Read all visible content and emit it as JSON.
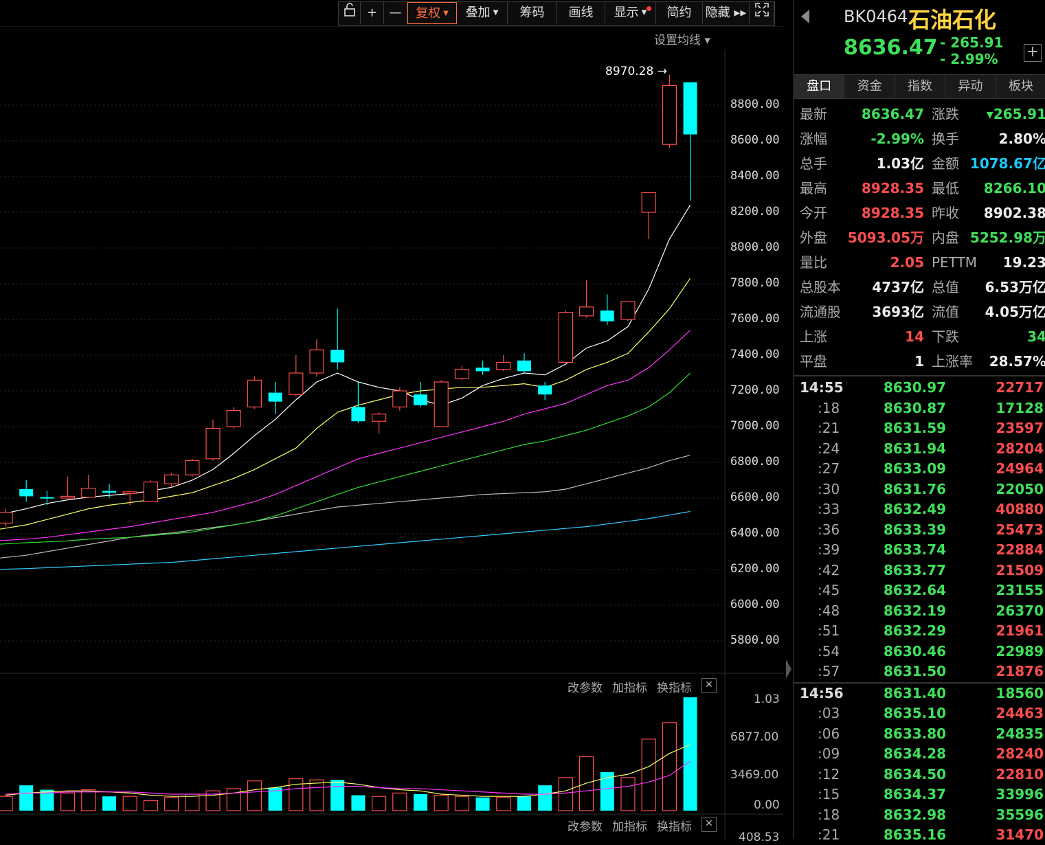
{
  "toolbar": {
    "items": [
      {
        "label": "",
        "icon": "unlock-icon"
      },
      {
        "label": "+",
        "icon": "zoom-in-icon"
      },
      {
        "label": "—",
        "icon": "zoom-out-icon"
      },
      {
        "label": "复权",
        "caret": true,
        "active": true
      },
      {
        "label": "叠加",
        "caret": true
      },
      {
        "label": "筹码"
      },
      {
        "label": "画线"
      },
      {
        "label": "显示",
        "caret": true,
        "dot": true
      },
      {
        "label": "简约"
      },
      {
        "label": "隐藏 ▸▸"
      },
      {
        "label": "",
        "icon": "fullscreen-icon"
      }
    ]
  },
  "main_chart": {
    "setting_label": "设置均线 ▾",
    "peak_label": "8970.28",
    "y_axis_labels": [
      "8800.00",
      "8600.00",
      "8400.00",
      "8200.00",
      "8000.00",
      "7800.00",
      "7600.00",
      "7400.00",
      "7200.00",
      "7000.00",
      "6800.00",
      "6600.00",
      "6400.00",
      "6200.00",
      "6000.00",
      "5800.00"
    ]
  },
  "volume_chart": {
    "tools": [
      "改参数",
      "加指标",
      "换指标"
    ],
    "y_axis_labels": [
      "1.03",
      "6877.00",
      "3469.00",
      "0.00"
    ]
  },
  "bottom_chart": {
    "tools": [
      "改参数",
      "加指标",
      "换指标"
    ],
    "y_axis_label": "408.53"
  },
  "colors": {
    "up": "#ff4d4d",
    "down": "#00ffff",
    "ma5": "#ffffff",
    "ma10": "#ffff66",
    "ma20": "#ff33ff",
    "ma30": "#33dd33",
    "ma60": "#bbbbbb",
    "ma120": "#33ccff"
  },
  "chart_data": {
    "type": "candlestick",
    "ylim": [
      5700,
      9000
    ],
    "candles": [
      {
        "o": 6520,
        "c": 6460,
        "h": 6540,
        "l": 6440,
        "up": true
      },
      {
        "o": 6650,
        "c": 6610,
        "h": 6700,
        "l": 6580,
        "up": false
      },
      {
        "o": 6605,
        "c": 6600,
        "h": 6640,
        "l": 6560,
        "up": false
      },
      {
        "o": 6600,
        "c": 6610,
        "h": 6720,
        "l": 6600,
        "up": true
      },
      {
        "o": 6605,
        "c": 6655,
        "h": 6730,
        "l": 6600,
        "up": true
      },
      {
        "o": 6640,
        "c": 6630,
        "h": 6680,
        "l": 6600,
        "up": false
      },
      {
        "o": 6625,
        "c": 6635,
        "h": 6640,
        "l": 6560,
        "up": true
      },
      {
        "o": 6580,
        "c": 6690,
        "h": 6700,
        "l": 6580,
        "up": true
      },
      {
        "o": 6680,
        "c": 6730,
        "h": 6740,
        "l": 6660,
        "up": true
      },
      {
        "o": 6730,
        "c": 6810,
        "h": 6820,
        "l": 6720,
        "up": true
      },
      {
        "o": 6820,
        "c": 6990,
        "h": 7040,
        "l": 6810,
        "up": true
      },
      {
        "o": 7000,
        "c": 7090,
        "h": 7110,
        "l": 6990,
        "up": true
      },
      {
        "o": 7110,
        "c": 7260,
        "h": 7280,
        "l": 7100,
        "up": true
      },
      {
        "o": 7190,
        "c": 7140,
        "h": 7250,
        "l": 7070,
        "up": false
      },
      {
        "o": 7180,
        "c": 7300,
        "h": 7400,
        "l": 7170,
        "up": true
      },
      {
        "o": 7300,
        "c": 7430,
        "h": 7490,
        "l": 7280,
        "up": true
      },
      {
        "o": 7430,
        "c": 7360,
        "h": 7660,
        "l": 7320,
        "up": false
      },
      {
        "o": 7110,
        "c": 7030,
        "h": 7250,
        "l": 7020,
        "up": false
      },
      {
        "o": 7030,
        "c": 7070,
        "h": 7080,
        "l": 6960,
        "up": true
      },
      {
        "o": 7110,
        "c": 7200,
        "h": 7220,
        "l": 7090,
        "up": true
      },
      {
        "o": 7180,
        "c": 7120,
        "h": 7250,
        "l": 7110,
        "up": false
      },
      {
        "o": 7000,
        "c": 7250,
        "h": 7260,
        "l": 7000,
        "up": true
      },
      {
        "o": 7270,
        "c": 7320,
        "h": 7340,
        "l": 7260,
        "up": true
      },
      {
        "o": 7330,
        "c": 7310,
        "h": 7370,
        "l": 7290,
        "up": false
      },
      {
        "o": 7320,
        "c": 7360,
        "h": 7400,
        "l": 7310,
        "up": true
      },
      {
        "o": 7370,
        "c": 7310,
        "h": 7410,
        "l": 7300,
        "up": false
      },
      {
        "o": 7230,
        "c": 7180,
        "h": 7250,
        "l": 7150,
        "up": false
      },
      {
        "o": 7360,
        "c": 7640,
        "h": 7650,
        "l": 7350,
        "up": true
      },
      {
        "o": 7620,
        "c": 7670,
        "h": 7820,
        "l": 7610,
        "up": true
      },
      {
        "o": 7650,
        "c": 7590,
        "h": 7740,
        "l": 7570,
        "up": false
      },
      {
        "o": 7600,
        "c": 7700,
        "h": 7700,
        "l": 7590,
        "up": true
      },
      {
        "o": 8200,
        "c": 8310,
        "h": 8310,
        "l": 8050,
        "up": true
      },
      {
        "o": 8580,
        "c": 8910,
        "h": 8970,
        "l": 8560,
        "up": true
      },
      {
        "o": 8928,
        "c": 8636,
        "h": 8928,
        "l": 8266,
        "up": false
      }
    ],
    "ma5": [
      6500,
      6540,
      6570,
      6590,
      6605,
      6615,
      6625,
      6640,
      6660,
      6700,
      6760,
      6850,
      6950,
      7040,
      7150,
      7250,
      7300,
      7250,
      7220,
      7200,
      7150,
      7120,
      7160,
      7230,
      7270,
      7300,
      7290,
      7350,
      7440,
      7480,
      7560,
      7770,
      8050,
      8240
    ],
    "ma10": [
      6420,
      6450,
      6480,
      6510,
      6540,
      6560,
      6575,
      6590,
      6610,
      6630,
      6670,
      6710,
      6760,
      6820,
      6880,
      6990,
      7080,
      7120,
      7150,
      7180,
      7200,
      7210,
      7220,
      7220,
      7230,
      7240,
      7220,
      7260,
      7320,
      7360,
      7410,
      7530,
      7660,
      7830
    ],
    "ma20": [
      6360,
      6370,
      6380,
      6395,
      6410,
      6425,
      6440,
      6460,
      6480,
      6500,
      6520,
      6550,
      6580,
      6620,
      6670,
      6720,
      6770,
      6820,
      6850,
      6880,
      6910,
      6940,
      6970,
      7000,
      7030,
      7070,
      7100,
      7130,
      7180,
      7230,
      7260,
      7330,
      7430,
      7540
    ],
    "ma30": [
      6340,
      6350,
      6355,
      6360,
      6370,
      6375,
      6380,
      6390,
      6400,
      6410,
      6430,
      6450,
      6470,
      6500,
      6540,
      6580,
      6620,
      6660,
      6690,
      6720,
      6750,
      6780,
      6810,
      6840,
      6870,
      6900,
      6920,
      6950,
      6980,
      7020,
      7060,
      7110,
      7190,
      7300
    ],
    "ma60": [
      6260,
      6280,
      6300,
      6320,
      6340,
      6360,
      6380,
      6395,
      6405,
      6420,
      6435,
      6450,
      6470,
      6490,
      6510,
      6530,
      6550,
      6560,
      6570,
      6580,
      6590,
      6600,
      6610,
      6620,
      6625,
      6630,
      6635,
      6650,
      6680,
      6710,
      6740,
      6770,
      6810,
      6840
    ],
    "ma120": [
      6200,
      6205,
      6210,
      6215,
      6220,
      6225,
      6230,
      6235,
      6240,
      6250,
      6260,
      6270,
      6280,
      6290,
      6300,
      6310,
      6320,
      6330,
      6340,
      6350,
      6360,
      6370,
      6380,
      6390,
      6400,
      6410,
      6420,
      6430,
      6440,
      6455,
      6470,
      6485,
      6505,
      6525
    ],
    "volume": [
      1.3,
      2.3,
      1.9,
      1.6,
      1.9,
      1.3,
      1.3,
      0.9,
      1.2,
      1.5,
      1.8,
      2.0,
      2.7,
      2.1,
      2.9,
      2.8,
      2.8,
      1.4,
      1.3,
      1.6,
      1.5,
      1.4,
      1.3,
      1.2,
      1.2,
      1.3,
      2.3,
      3.0,
      4.9,
      3.5,
      3.0,
      6.5,
      8.0,
      10.3
    ],
    "vol_ma1": [
      1.4,
      1.6,
      1.7,
      1.8,
      1.8,
      1.7,
      1.6,
      1.4,
      1.3,
      1.3,
      1.4,
      1.6,
      1.9,
      2.1,
      2.4,
      2.5,
      2.6,
      2.4,
      2.1,
      1.9,
      1.8,
      1.5,
      1.4,
      1.3,
      1.3,
      1.3,
      1.5,
      1.8,
      2.5,
      3.0,
      3.3,
      4.0,
      5.2,
      6.0
    ],
    "vol_ma2": [
      1.5,
      1.6,
      1.6,
      1.7,
      1.7,
      1.7,
      1.7,
      1.6,
      1.5,
      1.5,
      1.5,
      1.6,
      1.7,
      1.8,
      2.0,
      2.1,
      2.2,
      2.2,
      2.1,
      2.0,
      2.0,
      1.9,
      1.8,
      1.7,
      1.6,
      1.5,
      1.5,
      1.6,
      1.8,
      2.0,
      2.2,
      2.6,
      3.2,
      4.5
    ],
    "vol_ylim": [
      0,
      10.3
    ]
  },
  "panel": {
    "code": "BK0464",
    "name": "石油石化",
    "price": "8636.47",
    "change": "- 265.91",
    "change_pct": "- 2.99%",
    "tabs": [
      "盘口",
      "资金",
      "指数",
      "异动",
      "板块"
    ],
    "quote_rows": [
      {
        "l1": "最新",
        "v1": "8636.47",
        "c1": "green",
        "l2": "涨跌",
        "v2": "▾265.91",
        "c2": "green"
      },
      {
        "l1": "涨幅",
        "v1": "-2.99%",
        "c1": "green",
        "l2": "换手",
        "v2": "2.80%",
        "c2": "white"
      },
      {
        "l1": "总手",
        "v1": "1.03亿",
        "c1": "white",
        "l2": "金额",
        "v2": "1078.67亿",
        "c2": "cyan"
      },
      {
        "l1": "最高",
        "v1": "8928.35",
        "c1": "red",
        "l2": "最低",
        "v2": "8266.10",
        "c2": "green"
      },
      {
        "l1": "今开",
        "v1": "8928.35",
        "c1": "red",
        "l2": "昨收",
        "v2": "8902.38",
        "c2": "white"
      },
      {
        "l1": "外盘",
        "v1": "5093.05万",
        "c1": "red",
        "l2": "内盘",
        "v2": "5252.98万",
        "c2": "green"
      },
      {
        "l1": "量比",
        "v1": "2.05",
        "c1": "red",
        "l2": "PETTM",
        "v2": "19.23",
        "c2": "white"
      },
      {
        "l1": "总股本",
        "v1": "4737亿",
        "c1": "white",
        "l2": "总值",
        "v2": "6.53万亿",
        "c2": "white"
      },
      {
        "l1": "流通股",
        "v1": "3693亿",
        "c1": "white",
        "l2": "流值",
        "v2": "4.05万亿",
        "c2": "white"
      },
      {
        "l1": "上涨",
        "v1": "14",
        "c1": "red",
        "l2": "下跌",
        "v2": "34",
        "c2": "green"
      },
      {
        "l1": "平盘",
        "v1": "1",
        "c1": "white",
        "l2": "上涨率",
        "v2": "28.57%",
        "c2": "white"
      }
    ],
    "ticks": [
      {
        "t": "14:55",
        "p": "8630.97",
        "v": "22717",
        "vc": "red",
        "head": true
      },
      {
        "t": ":18",
        "p": "8630.87",
        "v": "17128",
        "vc": "green"
      },
      {
        "t": ":21",
        "p": "8631.59",
        "v": "23597",
        "vc": "red"
      },
      {
        "t": ":24",
        "p": "8631.94",
        "v": "28204",
        "vc": "red"
      },
      {
        "t": ":27",
        "p": "8633.09",
        "v": "24964",
        "vc": "red"
      },
      {
        "t": ":30",
        "p": "8631.76",
        "v": "22050",
        "vc": "green"
      },
      {
        "t": ":33",
        "p": "8632.49",
        "v": "40880",
        "vc": "red"
      },
      {
        "t": ":36",
        "p": "8633.39",
        "v": "25473",
        "vc": "red"
      },
      {
        "t": ":39",
        "p": "8633.74",
        "v": "22884",
        "vc": "red"
      },
      {
        "t": ":42",
        "p": "8633.77",
        "v": "21509",
        "vc": "red"
      },
      {
        "t": ":45",
        "p": "8632.64",
        "v": "23155",
        "vc": "green"
      },
      {
        "t": ":48",
        "p": "8632.19",
        "v": "26370",
        "vc": "green"
      },
      {
        "t": ":51",
        "p": "8632.29",
        "v": "21961",
        "vc": "red"
      },
      {
        "t": ":54",
        "p": "8630.46",
        "v": "22989",
        "vc": "green"
      },
      {
        "t": ":57",
        "p": "8631.50",
        "v": "21876",
        "vc": "red"
      },
      {
        "t": "14:56",
        "p": "8631.40",
        "v": "18560",
        "vc": "green",
        "head": true
      },
      {
        "t": ":03",
        "p": "8635.10",
        "v": "24463",
        "vc": "red"
      },
      {
        "t": ":06",
        "p": "8633.80",
        "v": "24835",
        "vc": "green"
      },
      {
        "t": ":09",
        "p": "8634.28",
        "v": "28240",
        "vc": "red"
      },
      {
        "t": ":12",
        "p": "8634.50",
        "v": "22810",
        "vc": "red"
      },
      {
        "t": ":15",
        "p": "8634.37",
        "v": "33996",
        "vc": "green"
      },
      {
        "t": ":18",
        "p": "8632.98",
        "v": "35596",
        "vc": "green"
      },
      {
        "t": ":21",
        "p": "8635.16",
        "v": "31470",
        "vc": "red"
      }
    ]
  }
}
